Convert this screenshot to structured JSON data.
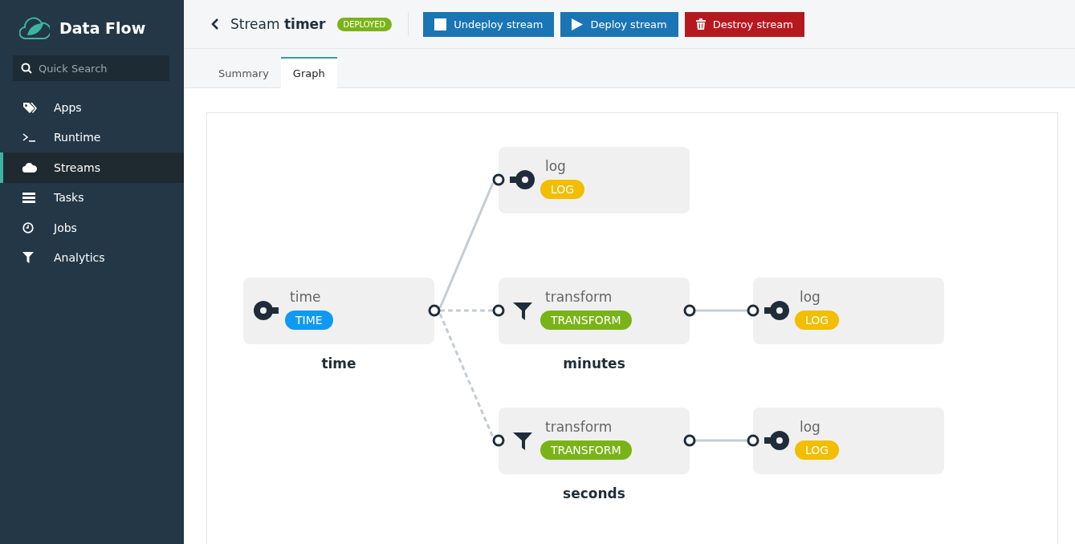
{
  "sidebar": {
    "brand": "Data Flow",
    "search": {
      "placeholder": "Quick Search"
    },
    "items": [
      {
        "label": "Apps",
        "kind": "tags",
        "selected": false
      },
      {
        "label": "Runtime",
        "kind": "terminal",
        "selected": false
      },
      {
        "label": "Streams",
        "kind": "cloud",
        "selected": true
      },
      {
        "label": "Tasks",
        "kind": "list",
        "selected": false
      },
      {
        "label": "Jobs",
        "kind": "clock",
        "selected": false
      },
      {
        "label": "Analytics",
        "kind": "funnel",
        "selected": false
      }
    ]
  },
  "header": {
    "title": "Stream **timer**",
    "status": "DEPLOYED",
    "buttons": [
      {
        "label": "Undeploy stream",
        "kind": "undeploy"
      },
      {
        "label": "Deploy stream",
        "kind": "deploy"
      },
      {
        "label": "Destroy stream",
        "kind": "destroy"
      }
    ]
  },
  "tabs": [
    {
      "label": "Summary",
      "selected": false
    },
    {
      "label": "Graph",
      "selected": true
    }
  ],
  "graph": {
    "taps": [
      {
        "name": "log",
        "badge": "LOG",
        "kind": "sink",
        "color": "#f3bd00"
      }
    ],
    "streams": [
      {
        "name": "time",
        "apps": [
          {
            "name": "time",
            "badge": "TIME",
            "kind": "source",
            "color": "#0f99f2"
          }
        ]
      },
      {
        "name": "minutes",
        "apps": [
          {
            "name": "transform",
            "badge": "TRANSFORM",
            "kind": "processor",
            "color": "#7ab317"
          },
          {
            "name": "log",
            "badge": "LOG",
            "kind": "sink",
            "color": "#f3bd00"
          }
        ]
      },
      {
        "name": "seconds",
        "apps": [
          {
            "name": "transform",
            "badge": "TRANSFORM",
            "kind": "processor",
            "color": "#7ab317"
          },
          {
            "name": "log",
            "badge": "LOG",
            "kind": "sink",
            "color": "#f3bd00"
          }
        ]
      }
    ]
  }
}
